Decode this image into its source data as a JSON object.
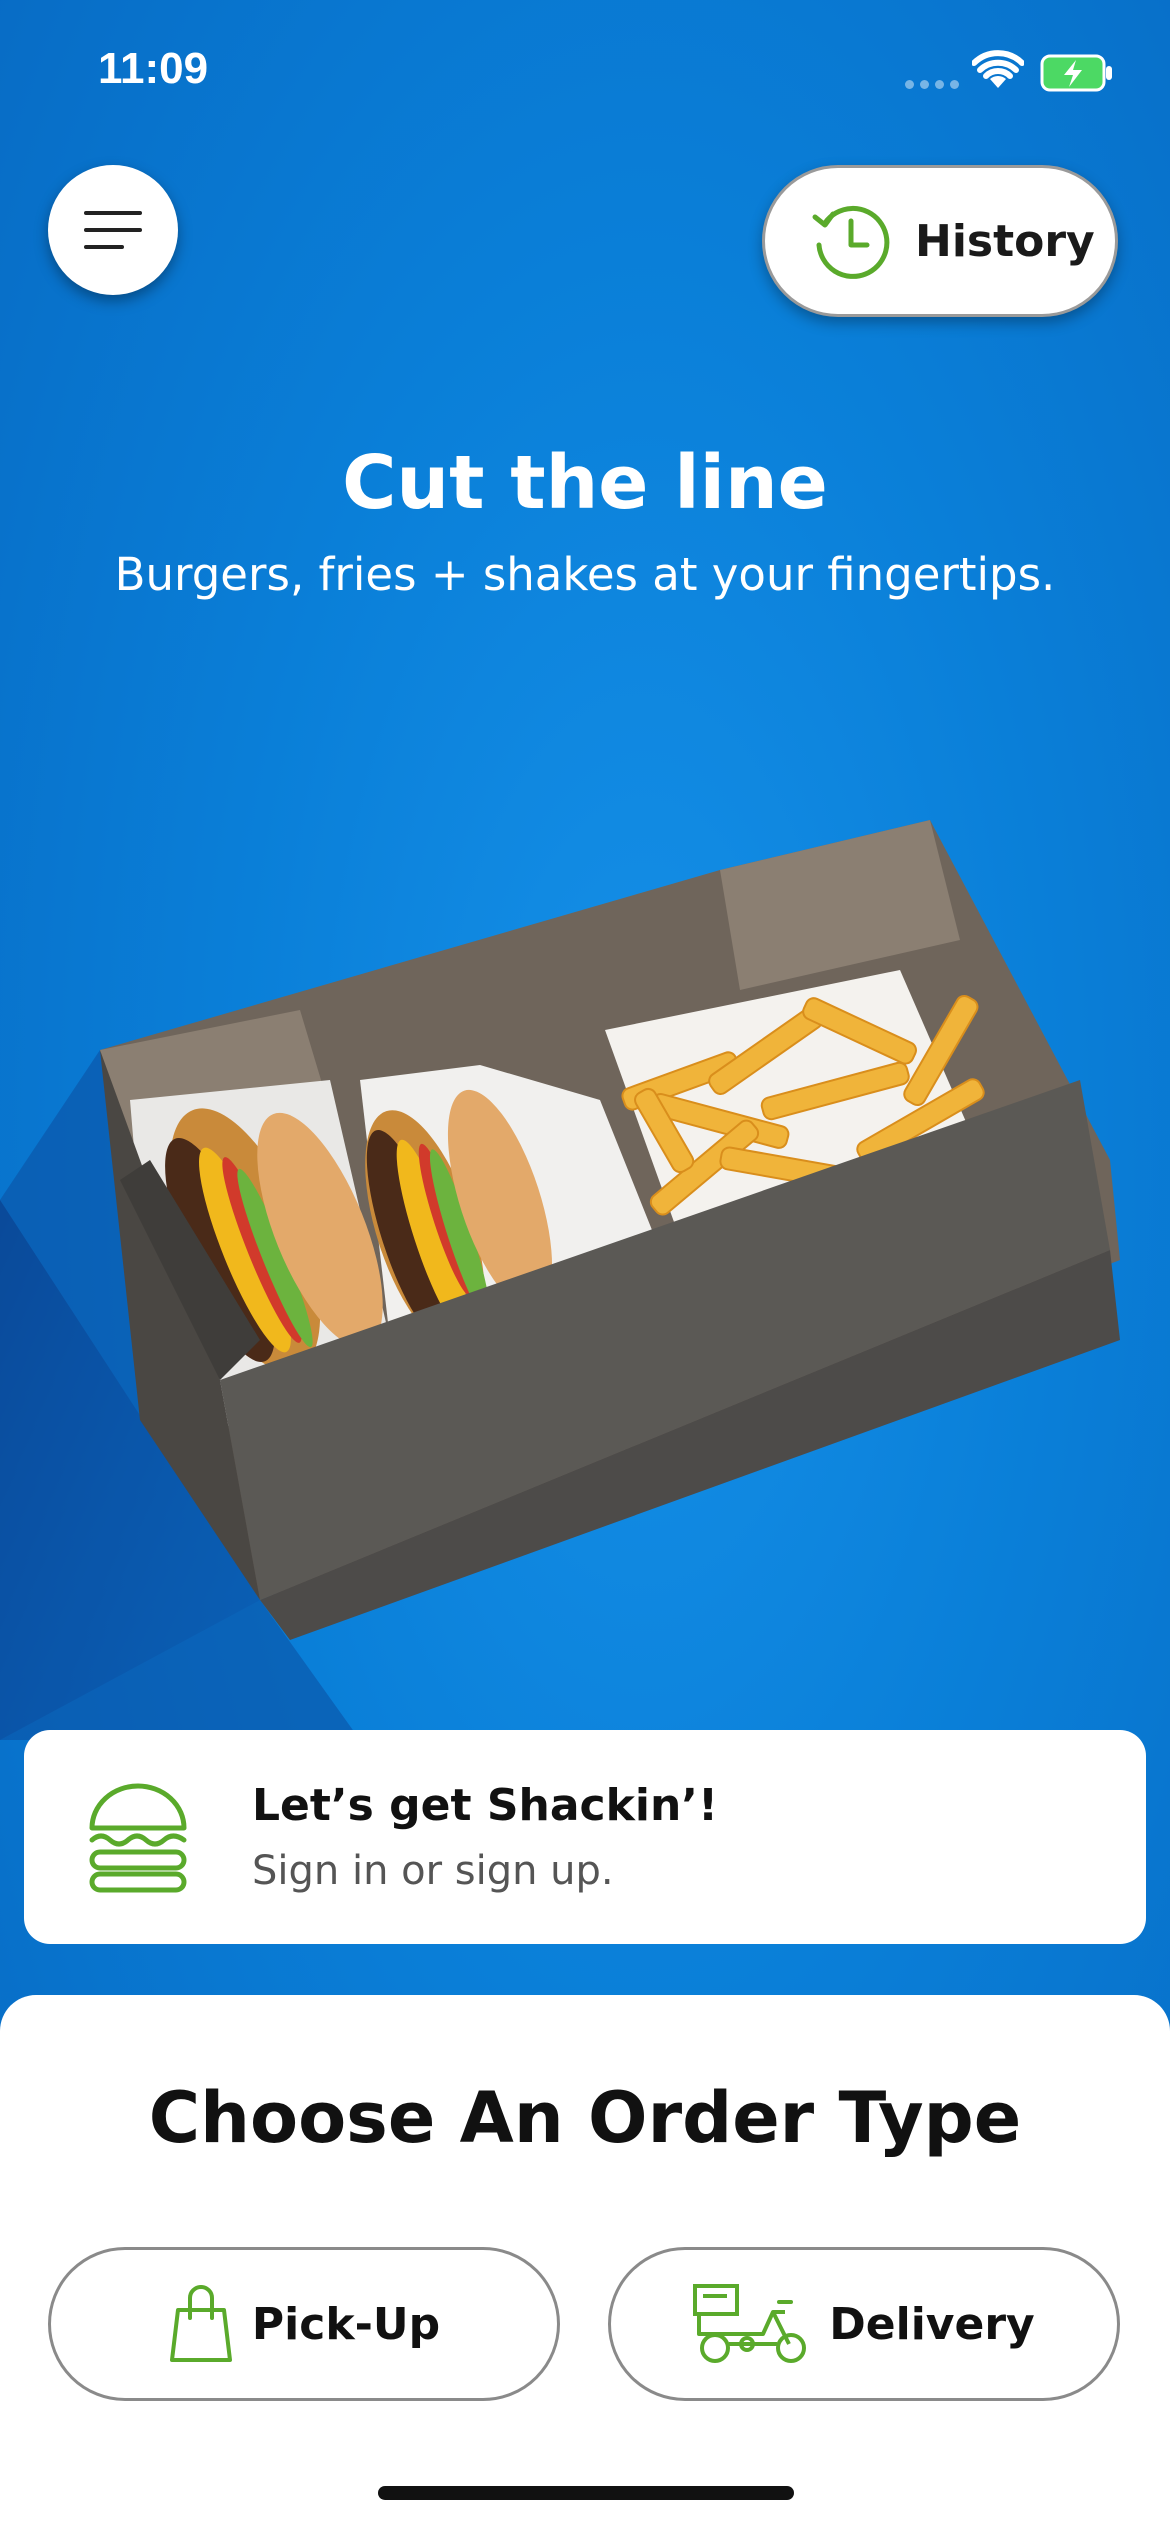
{
  "status_bar": {
    "time": "11:09"
  },
  "header": {
    "history_label": "History"
  },
  "hero": {
    "title": "Cut the line",
    "subtitle": "Burgers, fries + shakes at your fingertips."
  },
  "signin": {
    "title": "Let’s get Shackin’!",
    "subtitle": "Sign in or sign up."
  },
  "order": {
    "title": "Choose An Order Type",
    "pickup_label": "Pick-Up",
    "delivery_label": "Delivery"
  },
  "colors": {
    "background_blue": "#0c7ed6",
    "accent_green": "#5aaa2b",
    "text_dark": "#111111"
  },
  "icons": [
    "menu-icon",
    "history-clock-icon",
    "burger-icon",
    "shopping-bag-icon",
    "delivery-scooter-icon",
    "wifi-icon",
    "battery-icon"
  ]
}
